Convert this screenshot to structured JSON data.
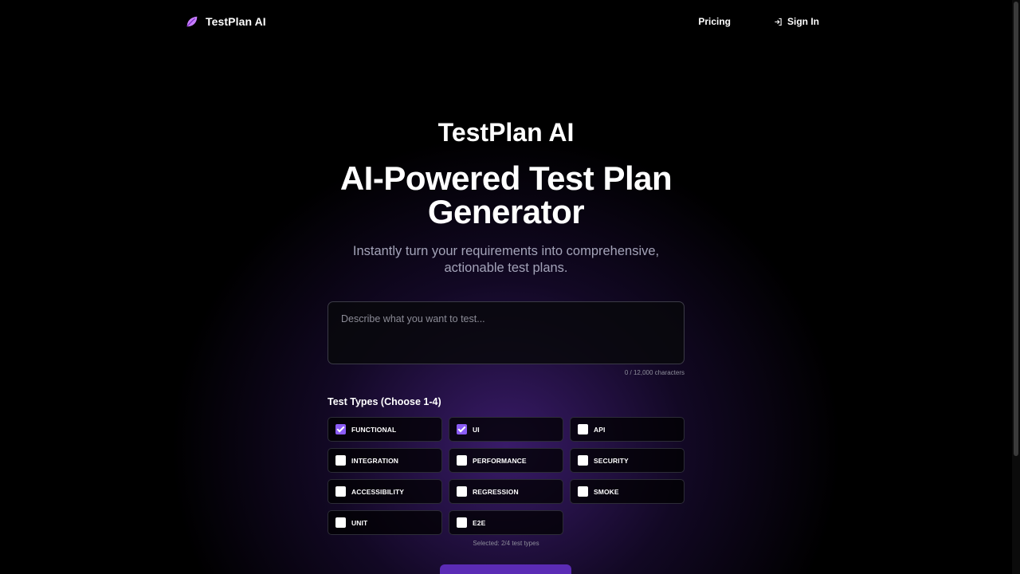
{
  "nav": {
    "brand": "TestPlan AI",
    "pricing": "Pricing",
    "sign_in": "Sign In"
  },
  "hero": {
    "kicker": "TestPlan AI",
    "title_line1": "AI-Powered Test Plan",
    "title_line2": "Generator",
    "subtitle_line1": "Instantly turn your requirements into comprehensive,",
    "subtitle_line2": "actionable test plans."
  },
  "input": {
    "placeholder": "Describe what you want to test...",
    "char_count": "0 / 12,000 characters"
  },
  "test_types": {
    "label": "Test Types (Choose 1-4)",
    "options": [
      {
        "label": "FUNCTIONAL",
        "checked": true
      },
      {
        "label": "UI",
        "checked": true
      },
      {
        "label": "API",
        "checked": false
      },
      {
        "label": "INTEGRATION",
        "checked": false
      },
      {
        "label": "PERFORMANCE",
        "checked": false
      },
      {
        "label": "SECURITY",
        "checked": false
      },
      {
        "label": "ACCESSIBILITY",
        "checked": false
      },
      {
        "label": "REGRESSION",
        "checked": false
      },
      {
        "label": "SMOKE",
        "checked": false
      },
      {
        "label": "UNIT",
        "checked": false
      },
      {
        "label": "E2E",
        "checked": false
      }
    ],
    "selected_note": "Selected: 2/4 test types"
  },
  "colors": {
    "accent": "#8b5cf6",
    "button": "#5b2bb5",
    "logo": "#c77dff"
  }
}
